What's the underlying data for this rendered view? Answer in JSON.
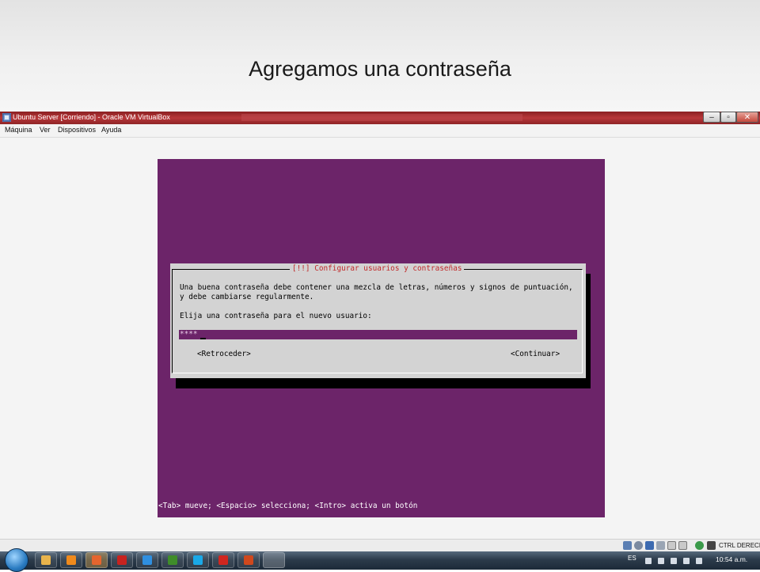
{
  "slide": {
    "title": "Agregamos una contraseña"
  },
  "window": {
    "title": "Ubuntu Server [Corriendo] - Oracle VM VirtualBox",
    "buttons": {
      "minimize": "–",
      "maximize": "▫",
      "close": "✕"
    }
  },
  "menu": {
    "items": [
      "Máquina",
      "Ver",
      "Dispositivos",
      "Ayuda"
    ]
  },
  "installer": {
    "dialog_title": "[!!] Configurar usuarios y contraseñas",
    "line1": "Una buena contraseña debe contener una mezcla de letras, números y signos de puntuación,",
    "line2": "y debe cambiarse regularmente.",
    "prompt": "Elija una contraseña para el nuevo usuario:",
    "password_value": "****",
    "back_button": "<Retroceder>",
    "continue_button": "<Continuar>",
    "status_line": "<Tab> mueve; <Espacio> selecciona; <Intro> activa un botón"
  },
  "statusbar": {
    "host_key": "CTRL DERECHA",
    "icons": [
      "hard-disk-icon",
      "optical-drive-icon",
      "usb-icon",
      "shared-folders-icon",
      "display-icon",
      "video-capture-icon",
      "network-icon",
      "mouse-integration-icon"
    ]
  },
  "taskbar": {
    "apps": [
      {
        "name": "file-explorer-icon",
        "color": "#e9b44c"
      },
      {
        "name": "media-player-icon",
        "color": "#f08a1c"
      },
      {
        "name": "firefox-icon",
        "color": "#e5652e"
      },
      {
        "name": "flash-icon",
        "color": "#c8231f"
      },
      {
        "name": "internet-explorer-icon",
        "color": "#2f8fe0"
      },
      {
        "name": "dreamweaver-icon",
        "color": "#3f8d2a"
      },
      {
        "name": "skype-icon",
        "color": "#1aa9e8"
      },
      {
        "name": "acrobat-icon",
        "color": "#d1261f"
      },
      {
        "name": "powerpoint-icon",
        "color": "#d0481d"
      },
      {
        "name": "virtualbox-icon",
        "color": "#6a8fc8"
      }
    ],
    "language": "ES",
    "clock": "10:54 a.m."
  },
  "colors": {
    "guest_background": "#6c2469",
    "dialog_background": "#d3d3d3",
    "dialog_title": "#c12a2a"
  }
}
